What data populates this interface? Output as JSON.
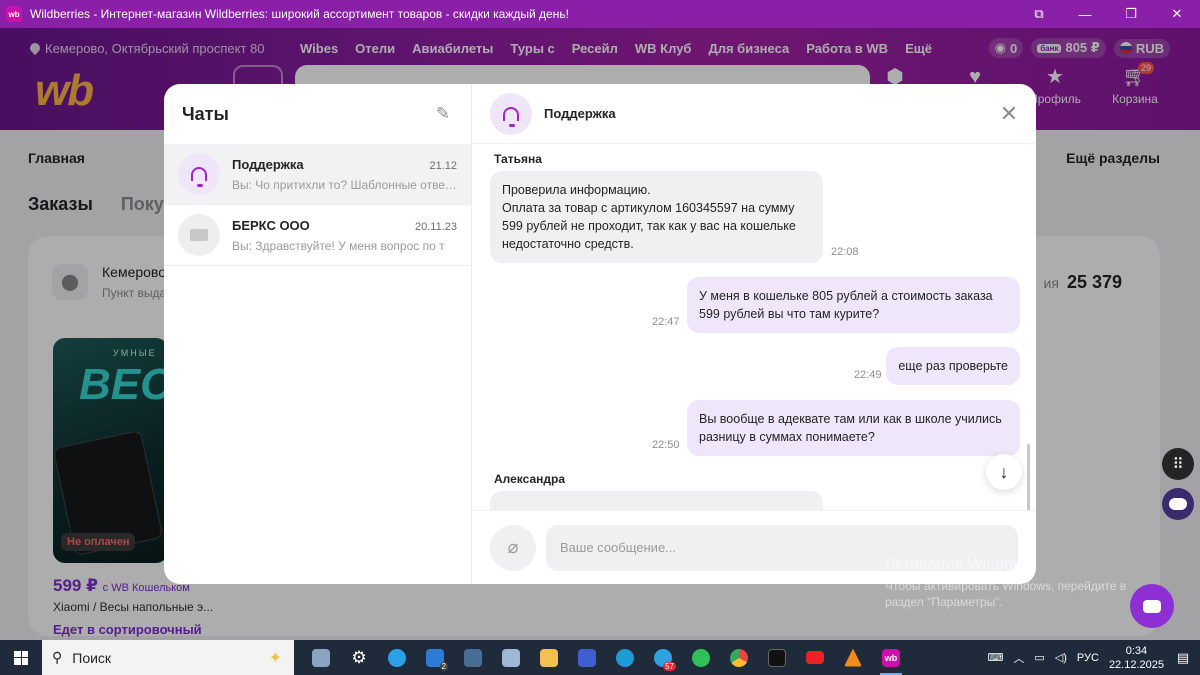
{
  "window": {
    "title": "Wildberries - Интернет-магазин Wildberries: широкий ассортимент товаров - скидки каждый день!",
    "app_icon": "wb"
  },
  "header": {
    "location": "Кемерово, Октябрьский проспект 80",
    "links": [
      "Wibes",
      "Отели",
      "Авиабилеты",
      "Туры с",
      "Ресейл",
      "WB Клуб",
      "Для бизнеса",
      "Работа в WB",
      "Ещё"
    ],
    "points": "0",
    "wallet_label": "банк",
    "wallet": "805 ₽",
    "currency": "RUB",
    "logo": "wb",
    "icons": [
      {
        "label": "",
        "icon": "box-icon"
      },
      {
        "label": "",
        "icon": "heart-icon"
      },
      {
        "label": "Профиль",
        "icon": "profile-icon"
      },
      {
        "label": "Корзина",
        "icon": "cart-icon",
        "badge": "29"
      }
    ]
  },
  "page": {
    "nav_home": "Главная",
    "nav_more": "Ещё разделы",
    "tab_orders": "Заказы",
    "tab_purchases": "Покуп",
    "order": {
      "city": "Кемерово",
      "pickup": "Пункт выда",
      "sum_label": "ия",
      "sum": "25 379",
      "product_banner_top": "УМНЫЕ",
      "product_banner_big": "ВЕС",
      "unpaid": "Не оплачен",
      "price": "599 ₽",
      "price_suffix": "с WB Кошельком",
      "name": "Xiaomi / Весы напольные э...",
      "status": "Едет в сортировочный"
    }
  },
  "chats": {
    "title": "Чаты",
    "items": [
      {
        "name": "Поддержка",
        "date": "21.12",
        "preview": "Вы: Чо притихли то? Шаблонные ответы",
        "active": true
      },
      {
        "name": "БЕРКС ООО",
        "date": "20.11.23",
        "preview": "Вы: Здравствуйте! У меня вопрос по т",
        "active": false
      }
    ]
  },
  "conversation": {
    "title": "Поддержка",
    "messages": [
      {
        "sender": "Татьяна"
      },
      {
        "dir": "in",
        "text": "Проверила информацию.\nОплата за товар с артикулом 160345597 на сумму 599 рублей не проходит, так как у вас на кошельке недостаточно средств.",
        "time": "22:08"
      },
      {
        "dir": "out",
        "text": "У меня в кошельке 805 рублей а стоимость заказа 599 рублей вы что там курите?",
        "time": "22:47"
      },
      {
        "dir": "out",
        "text": "еще раз проверьте",
        "time": "22:49"
      },
      {
        "dir": "out",
        "text": "Вы вообще в адеквате там или как в школе учились разницу в суммах понимаете?",
        "time": "22:50"
      },
      {
        "sender": "Александра"
      }
    ],
    "input_placeholder": "Ваше сообщение..."
  },
  "watermark": {
    "title": "Активация Windows",
    "line1": "Чтобы активировать Windows, перейдите в",
    "line2": "раздел \"Параметры\"."
  },
  "taskbar": {
    "search": "Поиск",
    "lang": "РУС",
    "time": "0:34",
    "date": "22.12.2025",
    "badges": {
      "files": "2",
      "telegram": "57"
    }
  },
  "colors": {
    "brand": "#a322a6",
    "accent": "#7f2ed0",
    "out_bubble": "#f0e6fb",
    "in_bubble": "#f0f0f3"
  }
}
